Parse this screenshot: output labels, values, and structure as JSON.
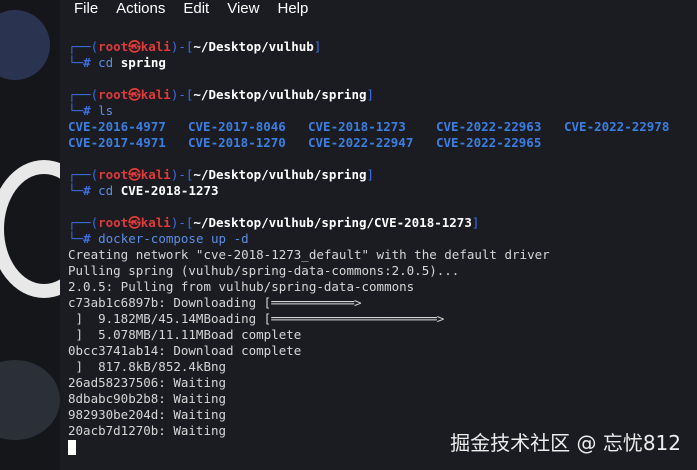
{
  "menu": [
    "File",
    "Actions",
    "Edit",
    "View",
    "Help"
  ],
  "prompts": [
    {
      "user": "root㉿kali",
      "path": "~/Desktop/vulhub",
      "cmd": "cd",
      "arg": " spring"
    },
    {
      "user": "root㉿kali",
      "path": "~/Desktop/vulhub/spring",
      "cmd": "ls",
      "arg": ""
    },
    {
      "user": "root㉿kali",
      "path": "~/Desktop/vulhub/spring",
      "cmd": "cd",
      "arg": " CVE-2018-1273"
    },
    {
      "user": "root㉿kali",
      "path": "~/Desktop/vulhub/spring/CVE-2018-1273",
      "cmd": "docker-compose up -d",
      "arg": ""
    }
  ],
  "ls_rows": [
    [
      "CVE-2016-4977",
      "CVE-2017-8046",
      "CVE-2018-1273",
      "CVE-2022-22963",
      "CVE-2022-22978"
    ],
    [
      "CVE-2017-4971",
      "CVE-2018-1270",
      "CVE-2022-22947",
      "CVE-2022-22965"
    ]
  ],
  "output": [
    "Creating network \"cve-2018-1273_default\" with the default driver",
    "Pulling spring (vulhub/spring-data-commons:2.0.5)...",
    "2.0.5: Pulling from vulhub/spring-data-commons",
    "c73ab1c6897b: Downloading [═══════════>",
    " ]  9.182MB/45.14MBoading [══════════════════════>",
    " ]  5.078MB/11.11MBoad complete",
    "0bcc3741ab14: Download complete",
    " ]  817.8kB/852.4kBng",
    "26ad58237506: Waiting",
    "8dbabc90b2b8: Waiting",
    "982930be204d: Waiting",
    "20acb7d1270b: Waiting"
  ],
  "watermark": "掘金技术社区 @ 忘忧812",
  "colors": {
    "frame": "#3b6fe0",
    "user": "#e03a3a",
    "background": "#1b1c22"
  }
}
